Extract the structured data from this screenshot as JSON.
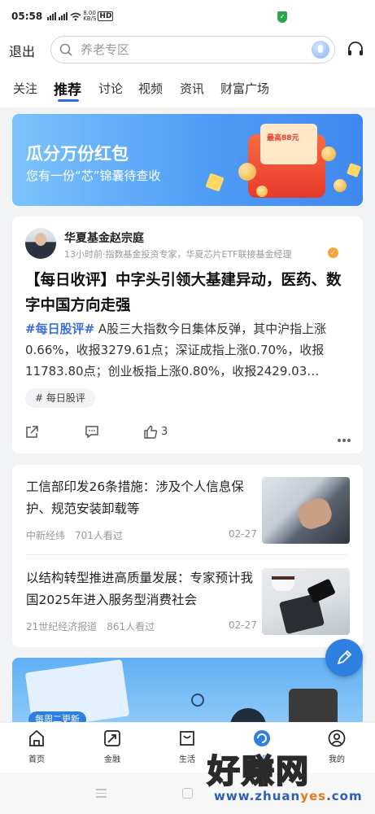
{
  "status_bar": {
    "time": "05:58",
    "network_speed_value": "8.00",
    "network_speed_unit": "KB/S",
    "hd": "HD"
  },
  "header": {
    "exit_label": "退出",
    "search_placeholder": "养老专区"
  },
  "tabs": [
    {
      "label": "关注"
    },
    {
      "label": "推荐",
      "active": true
    },
    {
      "label": "讨论"
    },
    {
      "label": "视频"
    },
    {
      "label": "资讯"
    },
    {
      "label": "财富广场"
    }
  ],
  "banner": {
    "title": "瓜分万份红包",
    "subtitle": "您有一份“芯”锦囊待查收",
    "card_text": "最高88元"
  },
  "post": {
    "author": "华夏基金赵宗庭",
    "meta": "13小时前·指数基金投资专家，华夏芯片ETF联接基金经理",
    "title": "【每日收评】中字头引领大基建异动，医药、数字中国方向走强",
    "hashtag": "#每日股评#",
    "body": " A股三大指数今日集体反弹，其中沪指上涨0.66%，收报3279.61点；深证成指上涨0.70%，收报11783.80点；创业板指上涨0.80%，收报2429.03…",
    "tag": "# 每日股评",
    "like_count": "3"
  },
  "news": [
    {
      "title": "工信部印发26条措施：涉及个人信息保护、规范安装卸载等",
      "source": "中新经纬　701人看过",
      "date": "02-27"
    },
    {
      "title": "以结构转型推进高质量发展：专家预计我国2025年进入服务型消费社会",
      "source": "21世纪经济报道　861人看过",
      "date": "02-27"
    }
  ],
  "promo": {
    "badge": "每周二更新"
  },
  "bottom_nav": [
    {
      "label": "首页"
    },
    {
      "label": "金融"
    },
    {
      "label": "生活"
    },
    {
      "label": "社区",
      "active": true
    },
    {
      "label": "我的"
    }
  ],
  "watermark": {
    "main": "好赚网",
    "url_prefix": "www.zhuan",
    "url_highlight": "yes",
    "url_suffix": ".com"
  },
  "colors": {
    "accent": "#2d7fe0",
    "hashtag": "#3a6fd8",
    "banner_start": "#7cc3fb",
    "banner_end": "#3f88ef"
  }
}
